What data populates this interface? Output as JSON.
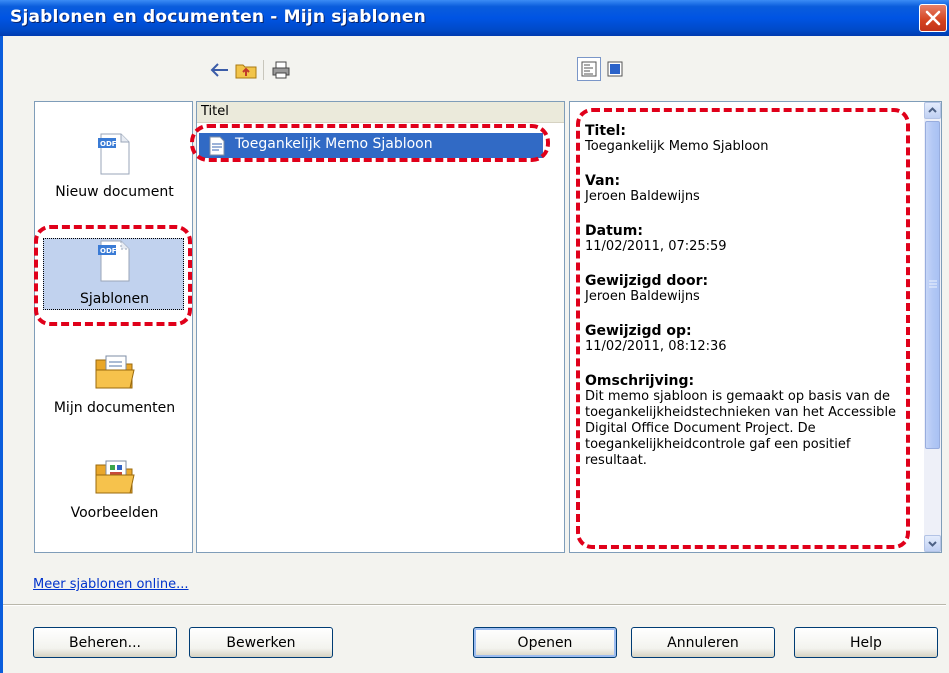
{
  "window": {
    "title": "Sjablonen en documenten - Mijn sjablonen"
  },
  "toolbar": {
    "icons": [
      "back-arrow-icon",
      "folder-up-icon",
      "print-icon"
    ],
    "view_icons": [
      "document-view-icon",
      "preview-view-icon"
    ]
  },
  "categories": [
    {
      "label": "Nieuw document",
      "icon": "odf-new-document-icon"
    },
    {
      "label": "Sjablonen",
      "icon": "odf-template-icon",
      "selected": true
    },
    {
      "label": "Mijn documenten",
      "icon": "folder-documents-icon"
    },
    {
      "label": "Voorbeelden",
      "icon": "folder-examples-icon"
    }
  ],
  "list": {
    "column_header": "Titel",
    "items": [
      {
        "label": "Toegankelijk Memo Sjabloon",
        "selected": true
      }
    ]
  },
  "info": {
    "fields": [
      {
        "key": "Titel:",
        "value": "Toegankelijk Memo Sjabloon"
      },
      {
        "key": "Van:",
        "value": "Jeroen Baldewijns"
      },
      {
        "key": "Datum:",
        "value": "11/02/2011, 07:25:59"
      },
      {
        "key": "Gewijzigd door:",
        "value": "Jeroen Baldewijns"
      },
      {
        "key": "Gewijzigd op:",
        "value": "11/02/2011, 08:12:36"
      },
      {
        "key": "Omschrijving:",
        "value": "Dit memo sjabloon is gemaakt op basis van de toegankelijkheidstechnieken van het Accessible Digital Office Document Project. De toegankelijkheidcontrole gaf een positief resultaat."
      }
    ]
  },
  "link": {
    "label": "Meer sjablonen online..."
  },
  "buttons": {
    "manage": "Beheren...",
    "edit": "Bewerken",
    "open": "Openen",
    "cancel": "Annuleren",
    "help": "Help"
  },
  "colors": {
    "highlight_dash": "#e0001a",
    "selection": "#316ac5"
  }
}
